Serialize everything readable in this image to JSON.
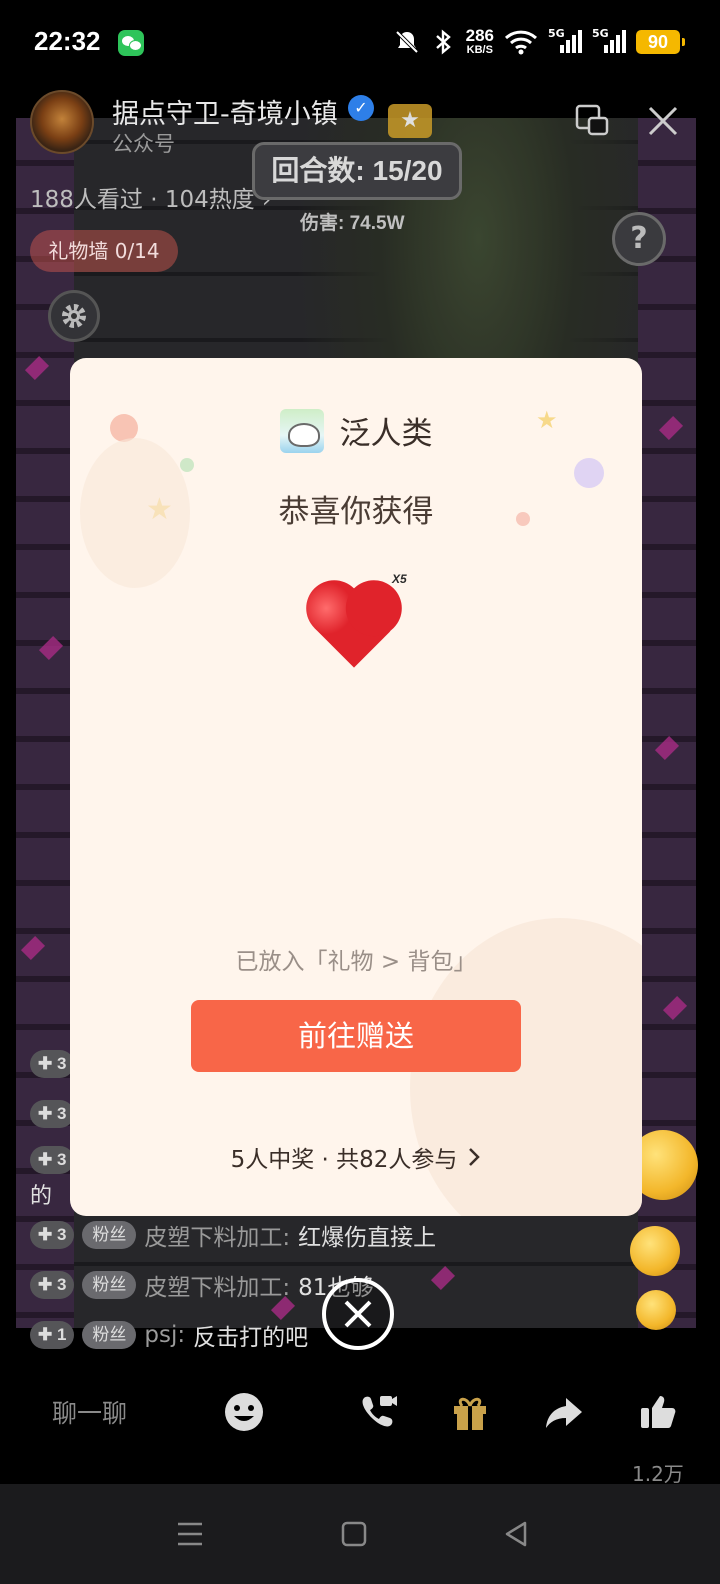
{
  "status_bar": {
    "time": "22:32",
    "network_speed": "286",
    "network_speed_unit": "KB/S",
    "signal_1_label": "5G",
    "signal_2_label": "5G",
    "battery": "90",
    "icons": [
      "wechat-icon",
      "mute-bell-icon",
      "bluetooth-icon",
      "wifi-icon",
      "signal-icon",
      "battery-icon"
    ]
  },
  "channel": {
    "name": "据点守卫-奇境小镇",
    "type": "公众号",
    "stats": "188人看过 · 104热度 ›"
  },
  "game": {
    "round": "回合数: 15/20",
    "damage": "伤害: 74.5W",
    "help": "?",
    "gift_wall": "礼物墙 0/14"
  },
  "modal": {
    "prize_name": "泛人类",
    "congrats": "恭喜你获得",
    "quantity": "X5",
    "placed_note": "已放入「礼物 > 背包」",
    "send_button": "前往赠送",
    "winners": "5人中奖 · 共82人参与"
  },
  "chat": {
    "stub_text": "的",
    "lines": [
      {
        "level": "✚ 3",
        "fan_label": "粉丝",
        "user": "皮塑下料加工:",
        "message": "红爆伤直接上"
      },
      {
        "level": "✚ 3",
        "fan_label": "粉丝",
        "user": "皮塑下料加工:",
        "message": "81也够"
      },
      {
        "level": "✚ 1",
        "fan_label": "粉丝",
        "user": "psj:",
        "message": "反击打的吧"
      }
    ],
    "partial_levels": [
      "✚ 3",
      "✚ 3",
      "✚ 3"
    ]
  },
  "toolbar": {
    "chat_placeholder": "聊一聊",
    "like_count": "1.2万"
  },
  "colors": {
    "send_button": "#f86648",
    "modal_bg": "#fff5ec",
    "battery": "#f5b800",
    "verified": "#2e7fe8"
  }
}
